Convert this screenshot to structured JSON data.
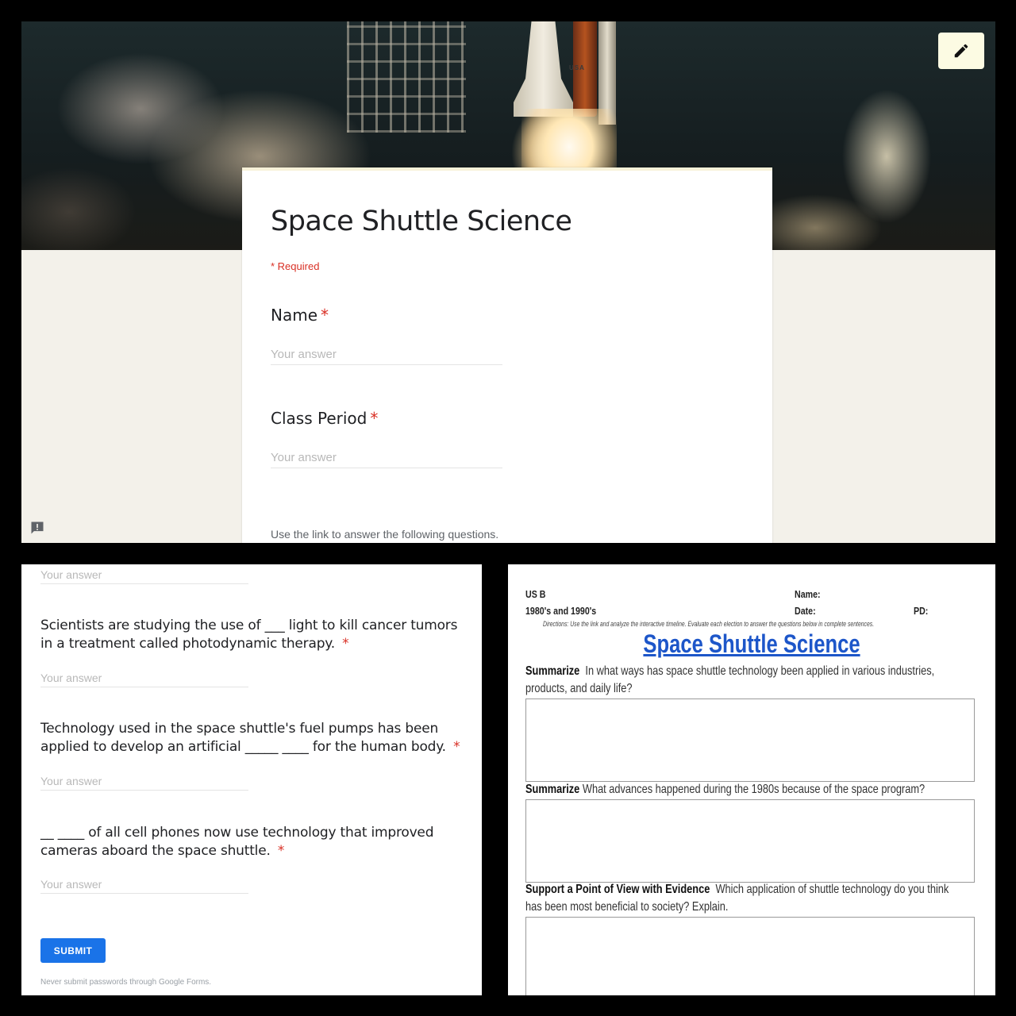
{
  "form_header": {
    "title": "Space Shuttle Science",
    "required_note": "* Required",
    "edit_icon": "pencil-icon",
    "feedback_icon": "report-feedback-icon",
    "banner_text": "USA",
    "questions": [
      {
        "label": "Name",
        "required_mark": "*",
        "placeholder": "Your answer"
      },
      {
        "label": "Class Period",
        "required_mark": "*",
        "placeholder": "Your answer"
      }
    ],
    "description": "Use the link to answer the following questions."
  },
  "form_continued": {
    "top_placeholder": "Your answer",
    "questions": [
      {
        "text": "Scientists are studying the use of ___ light to kill cancer tumors in a treatment called photodynamic therapy.",
        "required_mark": "*",
        "placeholder": "Your answer"
      },
      {
        "text": "Technology used in the space shuttle's fuel pumps has been applied to develop an artificial _____ ____ for the human body.",
        "required_mark": "*",
        "placeholder": "Your answer"
      },
      {
        "text": "__ ____ of all cell phones now use technology that improved cameras aboard the space shuttle.",
        "required_mark": "*",
        "placeholder": "Your answer"
      }
    ],
    "submit_label": "SUBMIT",
    "password_warning": "Never submit passwords through Google Forms."
  },
  "worksheet": {
    "course": "US B",
    "era": "1980's and 1990's",
    "name_label": "Name:",
    "date_label": "Date:",
    "pd_label": "PD:",
    "directions": "Directions: Use the link and analyze the interactive timeline. Evaluate each election to answer the questions below in complete sentences.",
    "title": "Space Shuttle Science",
    "questions": [
      {
        "skill": "Summarize",
        "text": "In what ways has space shuttle technology been applied in various industries, products, and daily life?"
      },
      {
        "skill": "Summarize",
        "text": "What advances happened during the 1980s because of the space program?"
      },
      {
        "skill": "Support a Point of View with Evidence",
        "text": "Which application of shuttle technology do you think has been most beneficial to society? Explain."
      }
    ]
  },
  "colors": {
    "required_red": "#d93025",
    "submit_blue": "#1a73e8",
    "worksheet_title_blue": "#1d56c9",
    "form_background": "#f3f1ea"
  }
}
